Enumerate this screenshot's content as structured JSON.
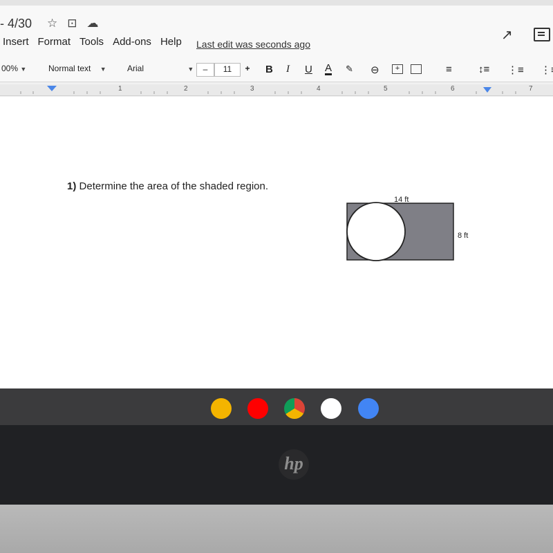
{
  "doc": {
    "title": "- 4/30",
    "icons": [
      "star-icon",
      "folder-move-icon",
      "cloud-icon"
    ]
  },
  "menu": {
    "items": [
      "Insert",
      "Format",
      "Tools",
      "Add-ons",
      "Help"
    ],
    "last_edit": "Last edit was seconds ago"
  },
  "toolbar": {
    "zoom": "00%",
    "style": "Normal text",
    "font": "Arial",
    "font_size": "11",
    "minus": "–",
    "plus": "+",
    "bold": "B",
    "italic": "I",
    "underline": "U",
    "text_color": "A"
  },
  "ruler": {
    "numbers": [
      "1",
      "2",
      "3",
      "4",
      "5",
      "6",
      "7"
    ]
  },
  "content": {
    "question_number": "1)",
    "question_text": "Determine the area of the shaded region.",
    "figure": {
      "width_label": "14 ft",
      "height_label": "8 ft",
      "shade_color": "#7f7f86"
    }
  },
  "shelf": {
    "apps": [
      {
        "name": "classroom-icon",
        "color": "#f4b400"
      },
      {
        "name": "youtube-icon",
        "color": "#ff0000"
      },
      {
        "name": "chrome-icon",
        "color": "#4285f4"
      },
      {
        "name": "drive-icon",
        "color": "#0f9d58"
      },
      {
        "name": "docs-icon",
        "color": "#4285f4"
      }
    ]
  },
  "device": {
    "logo": "hp"
  }
}
